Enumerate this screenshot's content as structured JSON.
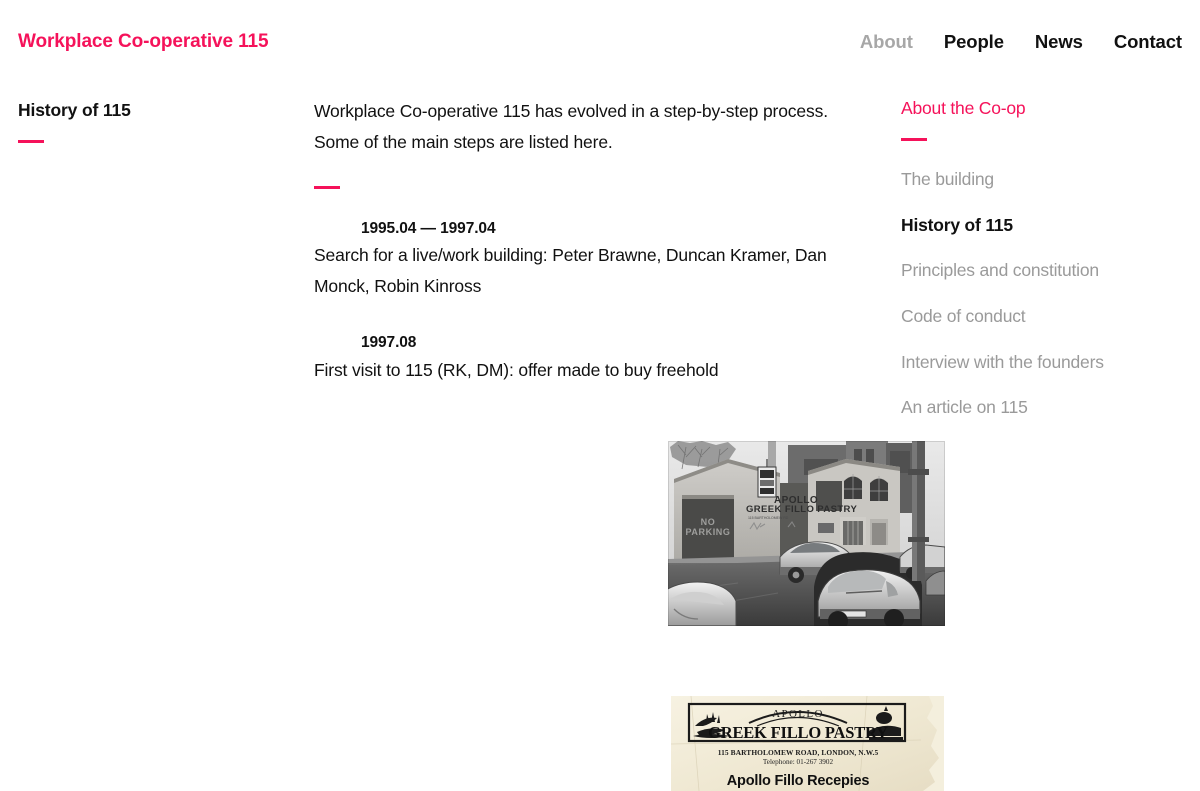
{
  "header": {
    "brand": "Workplace Co-operative 115",
    "nav": [
      {
        "label": "About",
        "state": "muted"
      },
      {
        "label": "People",
        "state": "default"
      },
      {
        "label": "News",
        "state": "default"
      },
      {
        "label": "Contact",
        "state": "default"
      }
    ]
  },
  "left": {
    "page_title": "History of 115"
  },
  "main": {
    "intro": "Workplace Co-operative 115 has evolved in a step-by-step process. Some of the main steps are listed here.",
    "timeline": [
      {
        "date": "1995.04 — 1997.04",
        "text": "Search for a live/work building: Peter Brawne, Duncan Kramer, Dan Monck, Robin Kinross"
      },
      {
        "date": "1997.08",
        "text": "First visit to 115 (RK, DM): offer made to buy freehold"
      }
    ],
    "figures": {
      "photo": {
        "alt": "Black and white photograph of a street with the Apollo Greek Fillo Pastry building and parked cars",
        "sign_top": "APOLLO",
        "sign_main": "GREEK FILLO PASTRY",
        "garage_text_line1": "NO",
        "garage_text_line2": "PARKING"
      },
      "leaflet": {
        "alt": "Scanned cream paper leaflet for Apollo Greek Fillo Pastry",
        "brand_top": "APOLLO",
        "brand_main": "GREEK FILLO PASTRY",
        "address": "115 BARTHOLOMEW ROAD, LONDON, N.W.5",
        "telephone": "Telephone: 01-267 3902",
        "headline": "Apollo Fillo Recepies"
      }
    }
  },
  "right": {
    "section_title": "About the Co-op",
    "links": [
      {
        "label": "The building",
        "state": "default"
      },
      {
        "label": "History of 115",
        "state": "active"
      },
      {
        "label": "Principles and constitution",
        "state": "default"
      },
      {
        "label": "Code of conduct",
        "state": "default"
      },
      {
        "label": "Interview with the founders",
        "state": "default"
      },
      {
        "label": "An article on 115",
        "state": "default"
      }
    ]
  },
  "theme": {
    "accent": "#f5125a",
    "text": "#111111",
    "muted": "#9a9a9a",
    "nav_muted": "#a7a7a7",
    "background": "#ffffff"
  }
}
